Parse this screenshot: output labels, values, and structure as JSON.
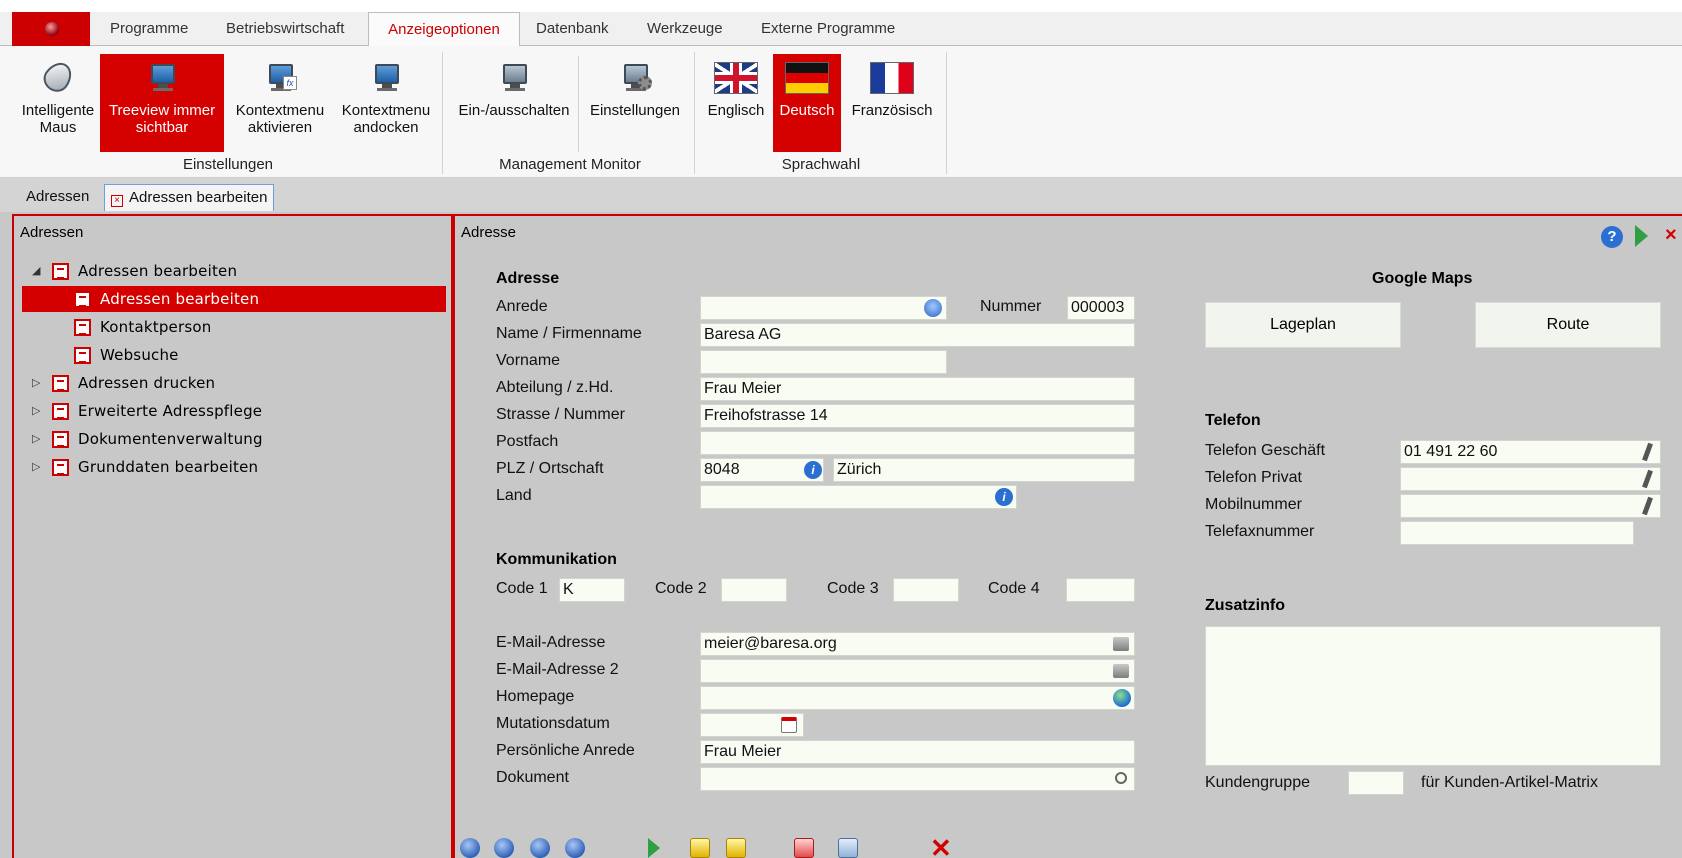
{
  "ribbon": {
    "tabs": [
      "Programme",
      "Betriebswirtschaft",
      "Anzeigeoptionen",
      "Datenbank",
      "Werkzeuge",
      "Externe Programme"
    ],
    "buttons": {
      "intelligente_maus": "Intelligente Maus",
      "treeview": "Treeview immer sichtbar",
      "kontextmenu_aktivieren": "Kontextmenu aktivieren",
      "kontextmenu_andocken": "Kontextmenu andocken",
      "ein_ausschalten": "Ein-/ausschalten",
      "einstellungen": "Einstellungen",
      "englisch": "Englisch",
      "deutsch": "Deutsch",
      "franzoesisch": "Französisch"
    },
    "groups": {
      "einstellungen": "Einstellungen",
      "management_monitor": "Management Monitor",
      "sprachwahl": "Sprachwahl"
    }
  },
  "doc_tabs": [
    "Adressen",
    "Adressen bearbeiten"
  ],
  "tree": {
    "title": "Adressen",
    "items": [
      "Adressen bearbeiten",
      "Adressen bearbeiten",
      "Kontaktperson",
      "Websuche",
      "Adressen drucken",
      "Erweiterte Adresspflege",
      "Dokumentenverwaltung",
      "Grunddaten bearbeiten"
    ]
  },
  "main": {
    "title": "Adresse",
    "section_adresse": "Adresse",
    "section_kommunikation": "Kommunikation",
    "section_google": "Google Maps",
    "section_telefon": "Telefon",
    "section_zusatz": "Zusatzinfo",
    "labels": {
      "anrede": "Anrede",
      "nummer": "Nummer",
      "name": "Name / Firmenname",
      "vorname": "Vorname",
      "abteilung": "Abteilung / z.Hd.",
      "strasse": "Strasse / Nummer",
      "postfach": "Postfach",
      "plz": "PLZ / Ortschaft",
      "land": "Land",
      "code1": "Code 1",
      "code2": "Code 2",
      "code3": "Code 3",
      "code4": "Code 4",
      "email": "E-Mail-Adresse",
      "email2": "E-Mail-Adresse 2",
      "homepage": "Homepage",
      "mutationsdatum": "Mutationsdatum",
      "pers_anrede": "Persönliche Anrede",
      "dokument": "Dokument",
      "tel_geschaeft": "Telefon Geschäft",
      "tel_privat": "Telefon Privat",
      "mobil": "Mobilnummer",
      "fax": "Telefaxnummer",
      "kundengruppe": "Kundengruppe",
      "kunden_matrix": "für Kunden-Artikel-Matrix"
    },
    "values": {
      "nummer": "000003",
      "name": "Baresa  AG",
      "abteilung": "Frau Meier",
      "strasse": "Freihofstrasse 14",
      "plz": "8048",
      "ort": "Zürich",
      "code1": "K",
      "email": "meier@baresa.org",
      "pers_anrede": "Frau Meier",
      "tel_geschaeft": "01 491 22 60"
    },
    "buttons": {
      "lageplan": "Lageplan",
      "route": "Route"
    }
  }
}
